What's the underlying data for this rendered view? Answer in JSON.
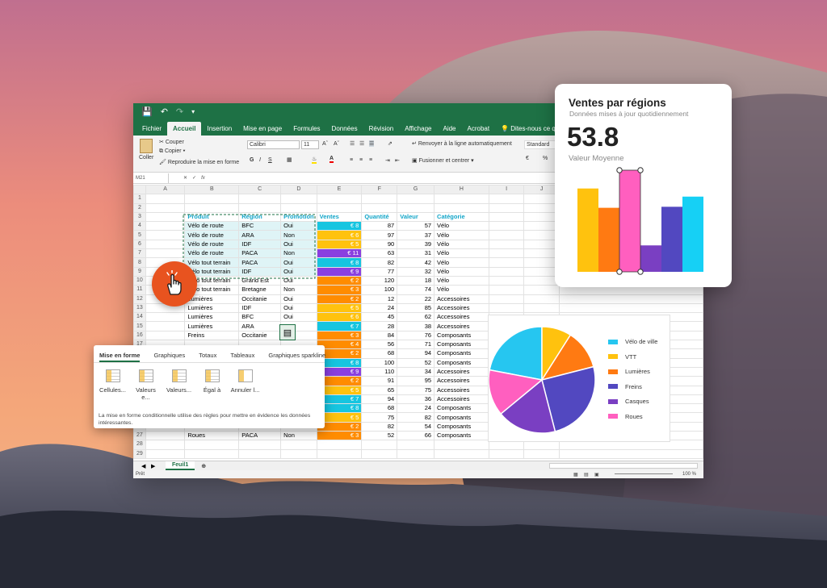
{
  "colors": {
    "excel_green": "#1e7145",
    "header_cyan": "#13a6c9",
    "accent_orange": "#e8531f"
  },
  "window": {
    "ribbon_tabs": [
      "Fichier",
      "Accueil",
      "Insertion",
      "Mise en page",
      "Formules",
      "Données",
      "Révision",
      "Affichage",
      "Aide",
      "Acrobat",
      "Dites-nous ce que vous"
    ],
    "active_tab": "Accueil",
    "clipboard": {
      "paste": "Coller",
      "cut": "Couper",
      "copy": "Copier",
      "format_painter": "Reproduire la mise en forme"
    },
    "font": {
      "name": "Calibri",
      "size": "11"
    },
    "wrap_text": "Renvoyer à la ligne automatiquement",
    "merge": "Fusionner et centrer",
    "number_format": "Standard",
    "name_box": "M21",
    "sheet_tab": "Feuil1",
    "status": "Prêt",
    "zoom": "100 %"
  },
  "sheet": {
    "columns": [
      "A",
      "B",
      "C",
      "D",
      "E",
      "F",
      "G",
      "H",
      "I",
      "J"
    ],
    "headers": [
      "Produit",
      "Région",
      "Promotion",
      "Ventes",
      "Quantité",
      "Valeur",
      "Catégorie"
    ],
    "rows": [
      [
        "Vélo de route",
        "BFC",
        "Oui",
        "€ 8",
        "87",
        "57",
        "Vélo"
      ],
      [
        "Vélo de route",
        "ARA",
        "Non",
        "€ 6",
        "97",
        "37",
        "Vélo"
      ],
      [
        "Vélo de route",
        "IDF",
        "Oui",
        "€ 5",
        "90",
        "39",
        "Vélo"
      ],
      [
        "Vélo de route",
        "PACA",
        "Non",
        "€ 11",
        "63",
        "31",
        "Vélo"
      ],
      [
        "Vélo tout terrain",
        "PACA",
        "Oui",
        "€ 8",
        "82",
        "42",
        "Vélo"
      ],
      [
        "Vélo tout terrain",
        "IDF",
        "Oui",
        "€ 9",
        "77",
        "32",
        "Vélo"
      ],
      [
        "Vélo tout terrain",
        "Grand Est",
        "Oui",
        "€ 2",
        "120",
        "18",
        "Vélo"
      ],
      [
        "Vélo tout terrain",
        "Bretagne",
        "Non",
        "€ 3",
        "100",
        "74",
        "Vélo"
      ],
      [
        "Lumières",
        "Occitanie",
        "Oui",
        "€ 2",
        "12",
        "22",
        "Accessoires"
      ],
      [
        "Lumières",
        "IDF",
        "Oui",
        "€ 5",
        "24",
        "85",
        "Accessoires"
      ],
      [
        "Lumières",
        "BFC",
        "Oui",
        "€ 6",
        "45",
        "62",
        "Accessoires"
      ],
      [
        "Lumières",
        "ARA",
        "",
        "€ 7",
        "28",
        "38",
        "Accessoires"
      ],
      [
        "Freins",
        "Occitanie",
        "",
        "€ 3",
        "84",
        "76",
        "Composants"
      ],
      [
        "",
        "",
        "",
        "€ 4",
        "56",
        "71",
        "Composants"
      ],
      [
        "",
        "",
        "",
        "€ 2",
        "68",
        "94",
        "Composants"
      ],
      [
        "",
        "",
        "",
        "€ 8",
        "100",
        "52",
        "Composants"
      ],
      [
        "",
        "",
        "",
        "€ 9",
        "110",
        "34",
        "Accessoires"
      ],
      [
        "",
        "",
        "",
        "€ 2",
        "91",
        "95",
        "Accessoires"
      ],
      [
        "",
        "",
        "",
        "€ 5",
        "65",
        "75",
        "Accessoires"
      ],
      [
        "",
        "",
        "",
        "€ 7",
        "94",
        "36",
        "Accessoires"
      ],
      [
        "",
        "",
        "",
        "€ 8",
        "68",
        "24",
        "Composants"
      ],
      [
        "",
        "",
        "",
        "€ 5",
        "75",
        "82",
        "Composants"
      ],
      [
        "Roues",
        "Grand Est",
        "",
        "€ 2",
        "82",
        "54",
        "Composants"
      ],
      [
        "Roues",
        "PACA",
        "Non",
        "€ 3",
        "52",
        "66",
        "Composants"
      ]
    ],
    "sales_colors": [
      "#16c5e0",
      "#ffc20e",
      "#ffc20e",
      "#8a3fe0",
      "#16c5e0",
      "#8a3fe0",
      "#ff8c00",
      "#ff8c00",
      "#ff8c00",
      "#ffc20e",
      "#ffc20e",
      "#16c5e0",
      "#ff8c00",
      "#ff8c00",
      "#ff8c00",
      "#16c5e0",
      "#8a3fe0",
      "#ff8c00",
      "#ffc20e",
      "#16c5e0",
      "#16c5e0",
      "#ffc20e",
      "#ff8c00",
      "#ff8c00"
    ]
  },
  "quick_analysis": {
    "tabs": [
      "Mise en forme",
      "Graphiques",
      "Totaux",
      "Tableaux",
      "Graphiques sparkline"
    ],
    "items": [
      "Cellules...",
      "Valeurs e...",
      "Valeurs...",
      "Égal à",
      "Annuler l..."
    ],
    "description": "La mise en forme conditionnelle utilise des règles pour mettre en évidence les données intéressantes."
  },
  "sales_card": {
    "title": "Ventes par régions",
    "subtitle": "Données mises à jour quotidiennement",
    "value": "53.8",
    "value_label": "Valeur Moyenne"
  },
  "chart_data": [
    {
      "type": "bar",
      "title": "Ventes par régions",
      "values": [
        82,
        63,
        100,
        26,
        64,
        74
      ],
      "colors": [
        "#ffc20e",
        "#ff7a12",
        "#ff5fbf",
        "#7a3fc2",
        "#5248c0",
        "#16d0f5"
      ],
      "ylim": [
        0,
        100
      ]
    },
    {
      "type": "pie",
      "labels": [
        "Vélo de ville",
        "VTT",
        "Lumières",
        "Freins",
        "Casques",
        "Roues"
      ],
      "values": [
        22,
        9,
        12,
        25,
        18,
        14
      ],
      "colors": [
        "#26c6f0",
        "#ffc20e",
        "#ff7a12",
        "#5248c0",
        "#7a3fc2",
        "#ff5fbf"
      ]
    }
  ]
}
